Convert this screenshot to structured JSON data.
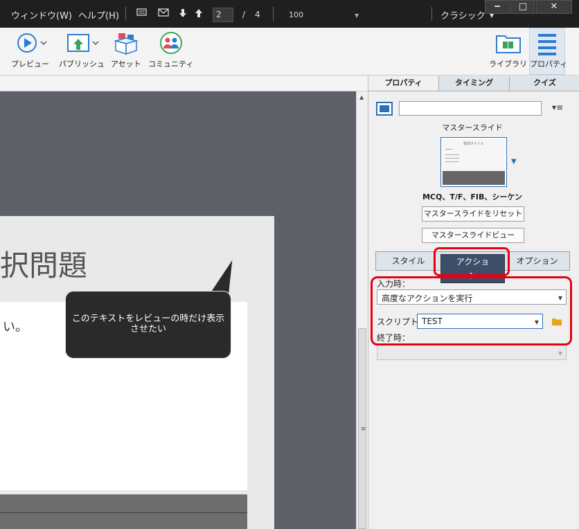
{
  "menubar": {
    "window_menu": "ウィンドウ(W)",
    "help_menu": "ヘルプ(H)",
    "page_current": "2",
    "page_separator": "/",
    "page_total": "4",
    "zoom": "100",
    "workspace": "クラシック"
  },
  "toolbar": {
    "preview": "プレビュー",
    "publish": "パブリッシュ",
    "assets": "アセット",
    "community": "コミュニティ",
    "library": "ライブラリ",
    "properties": "プロパティ"
  },
  "slide": {
    "title": "択問題",
    "body_text": "い。",
    "callout_text": "このテキストをレビューの時だけ表示させたい"
  },
  "panel": {
    "tabs": [
      "プロパティ",
      "タイミング",
      "クイズ"
    ],
    "name_value": "",
    "master_slide_label": "マスタースライド",
    "thumbnail_title": "質問タイトル",
    "master_slide_name": "MCQ、T/F、FIB、シーケン",
    "reset_button": "マスタースライドをリセット",
    "view_button": "マスタースライドビュー",
    "subtabs": [
      "スタイル",
      "アクション",
      "オプション"
    ],
    "on_enter_label": "入力時：",
    "on_enter_value": "高度なアクションを実行",
    "script_label": "スクリプト：",
    "script_value": "TEST",
    "on_exit_label": "終了時：",
    "on_exit_value": ""
  },
  "colors": {
    "highlight": "#e60012",
    "accent": "#2c6fb4",
    "active_subtab": "#3d4f68"
  }
}
